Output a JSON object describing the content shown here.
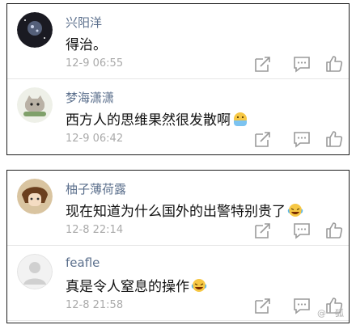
{
  "panels": [
    {
      "comments": [
        {
          "username": "兴阳洋",
          "text": "得治。",
          "time": "12-9 06:55",
          "avatar_icon": "dark-galaxy-avatar",
          "emoji": ""
        },
        {
          "username": "梦海潇潇",
          "text": "西方人的思维果然很发散啊",
          "time": "12-9 06:42",
          "avatar_icon": "cartoon-cat-avatar",
          "emoji": "hungry-face-emoji"
        }
      ]
    },
    {
      "comments": [
        {
          "username": "柚子薄荷露",
          "text": "现在知道为什么国外的出警特别贵了",
          "time": "12-8 22:14",
          "avatar_icon": "anime-character-avatar",
          "emoji": "laughing-tears-emoji"
        },
        {
          "username": "feafle",
          "text": "真是令人窒息的操作",
          "time": "12-8 21:58",
          "avatar_icon": "default-gray-avatar",
          "emoji": "laughing-tears-emoji"
        }
      ]
    }
  ],
  "actions": {
    "share_icon": "share-icon",
    "comment_icon": "comment-icon",
    "like_icon": "thumbs-up-icon"
  },
  "watermark": "@一狐"
}
